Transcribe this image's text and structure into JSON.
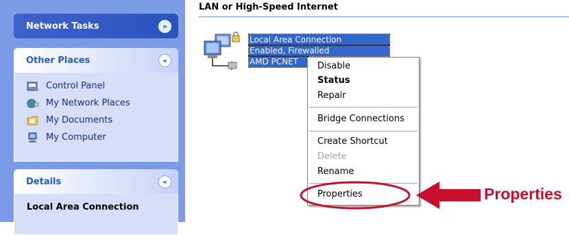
{
  "taskpane": {
    "network_tasks": {
      "title": "Network Tasks",
      "toggle": "expand"
    },
    "other_places": {
      "title": "Other Places",
      "toggle": "collapse",
      "items": [
        {
          "label": "Control Panel",
          "icon": "control-panel-icon"
        },
        {
          "label": "My Network Places",
          "icon": "network-places-icon"
        },
        {
          "label": "My Documents",
          "icon": "documents-folder-icon"
        },
        {
          "label": "My Computer",
          "icon": "computer-icon"
        }
      ]
    },
    "details": {
      "title": "Details",
      "toggle": "collapse",
      "content_title": "Local Area Connection"
    }
  },
  "content": {
    "section_title": "LAN or High-Speed Internet",
    "connection": {
      "icon": "lan-connection-icon",
      "name": "Local Area Connection",
      "status": "Enabled, Firewalled",
      "device": "AMD PCNET"
    }
  },
  "context_menu": {
    "items": [
      {
        "label": "Disable",
        "style": "normal"
      },
      {
        "label": "Status",
        "style": "bold"
      },
      {
        "label": "Repair",
        "style": "normal"
      },
      {
        "label": "Bridge Connections",
        "style": "normal"
      },
      {
        "label": "Create Shortcut",
        "style": "normal"
      },
      {
        "label": "Delete",
        "style": "disabled"
      },
      {
        "label": "Rename",
        "style": "normal"
      },
      {
        "label": "Properties",
        "style": "normal"
      }
    ]
  },
  "annotation": {
    "label": "Properties",
    "color": "#c8102e"
  },
  "colors": {
    "taskpane_bg": "#7b9be6",
    "selection": "#3366cc",
    "link": "#0c2d9c"
  }
}
